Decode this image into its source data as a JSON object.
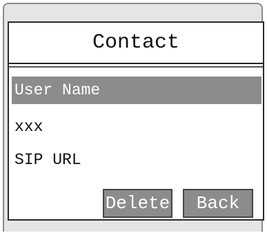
{
  "screen": {
    "title": "Contact"
  },
  "fields": [
    {
      "label": "User Name",
      "selected": true
    },
    {
      "label": "xxx",
      "selected": false
    },
    {
      "label": "SIP URL",
      "selected": false
    }
  ],
  "buttons": {
    "delete_label": "Delete",
    "back_label": "Back"
  },
  "colors": {
    "selection": "#8c8c8c",
    "device_frame": "#e5e5e5",
    "screen_bg": "#ffffff"
  }
}
